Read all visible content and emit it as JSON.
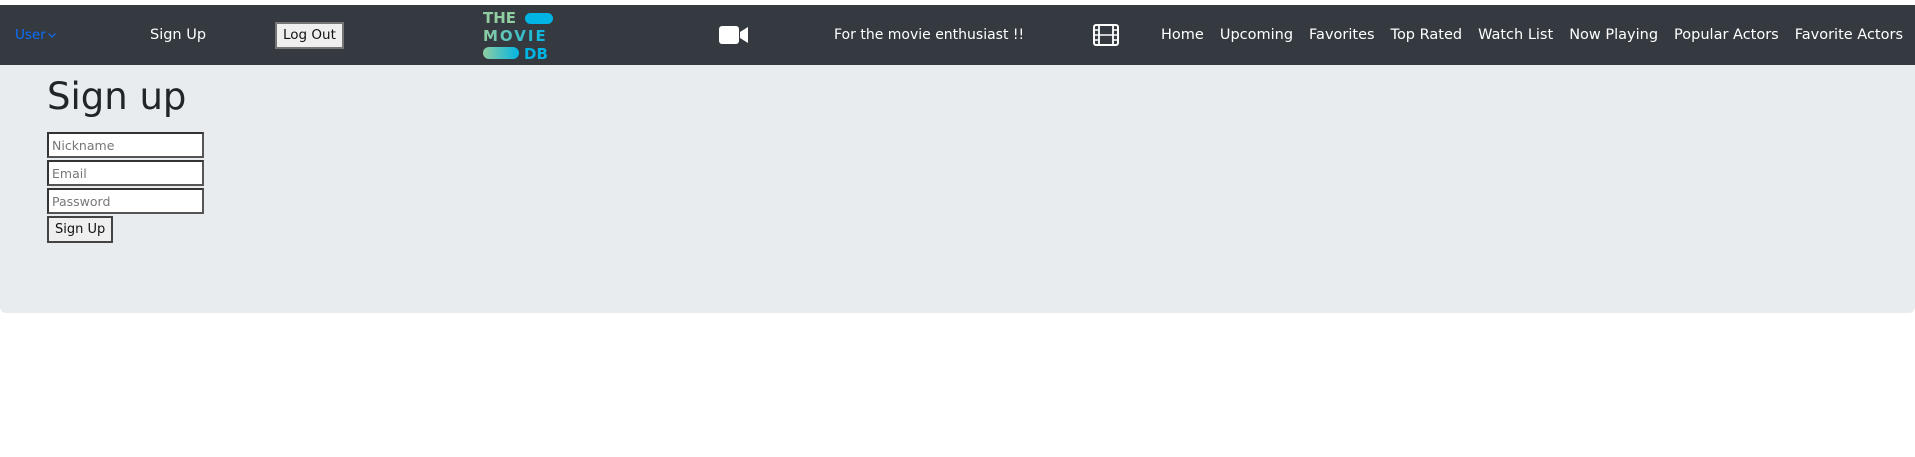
{
  "navbar": {
    "user_dropdown": "User",
    "signup_link": "Sign Up",
    "logout_button": "Log Out",
    "logo": {
      "line1": "THE",
      "line2": "MOVIE",
      "line3": "DB",
      "colors": {
        "teal": "#90cea1",
        "blue": "#01b4e4"
      }
    },
    "tagline": "For the movie enthusiast !!",
    "menu": [
      "Home",
      "Upcoming",
      "Favorites",
      "Top Rated",
      "Watch List",
      "Now Playing",
      "Popular Actors",
      "Favorite Actors"
    ]
  },
  "icons": {
    "camera": "video-camera-icon",
    "film": "film-icon",
    "chevron": "chevron-down-icon"
  },
  "main": {
    "title": "Sign up",
    "fields": {
      "nickname": {
        "placeholder": "Nickname",
        "value": ""
      },
      "email": {
        "placeholder": "Email",
        "value": ""
      },
      "password": {
        "placeholder": "Password",
        "value": ""
      }
    },
    "submit_label": "Sign Up"
  },
  "colors": {
    "navbar_bg": "#343a40",
    "jumbotron_bg": "#e9ecef",
    "link_blue": "#0d6efd"
  }
}
